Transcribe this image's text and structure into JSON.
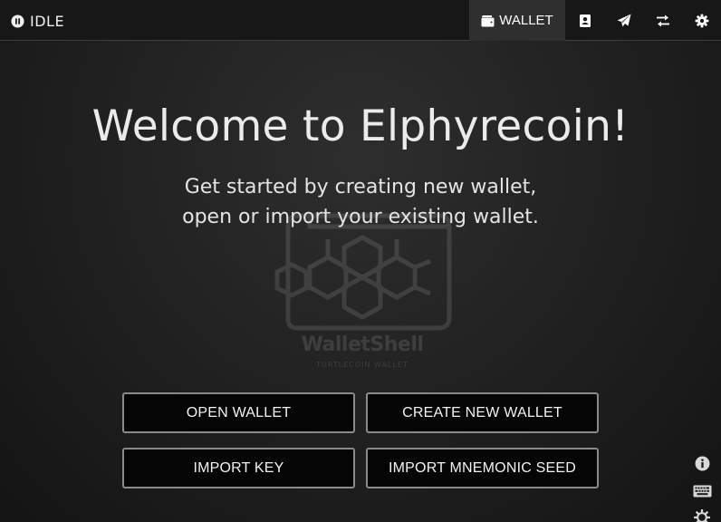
{
  "status": {
    "label": "IDLE",
    "icon": "pause-circle-icon"
  },
  "nav": {
    "wallet_label": "WALLET",
    "items": [
      {
        "name": "address-book",
        "icon": "address-book-icon"
      },
      {
        "name": "send",
        "icon": "paper-plane-icon"
      },
      {
        "name": "transactions",
        "icon": "exchange-icon"
      },
      {
        "name": "settings",
        "icon": "gear-icon"
      }
    ]
  },
  "main": {
    "title": "Welcome to Elphyrecoin!",
    "subtitle_line1": "Get started by creating new wallet,",
    "subtitle_line2": "open or import your existing wallet."
  },
  "watermark": {
    "name": "WalletShell",
    "subtitle": "TURTLECOIN WALLET"
  },
  "buttons": {
    "open": "OPEN WALLET",
    "create": "CREATE NEW WALLET",
    "import_key": "IMPORT KEY",
    "import_seed": "IMPORT MNEMONIC SEED"
  },
  "side_icons": [
    "info-icon",
    "keyboard-icon",
    "theme-toggle-icon"
  ],
  "colors": {
    "topbar": "#171717",
    "active_tab": "#2f2f2f",
    "button_border": "#8a8a8a",
    "button_bg": "#050505"
  }
}
